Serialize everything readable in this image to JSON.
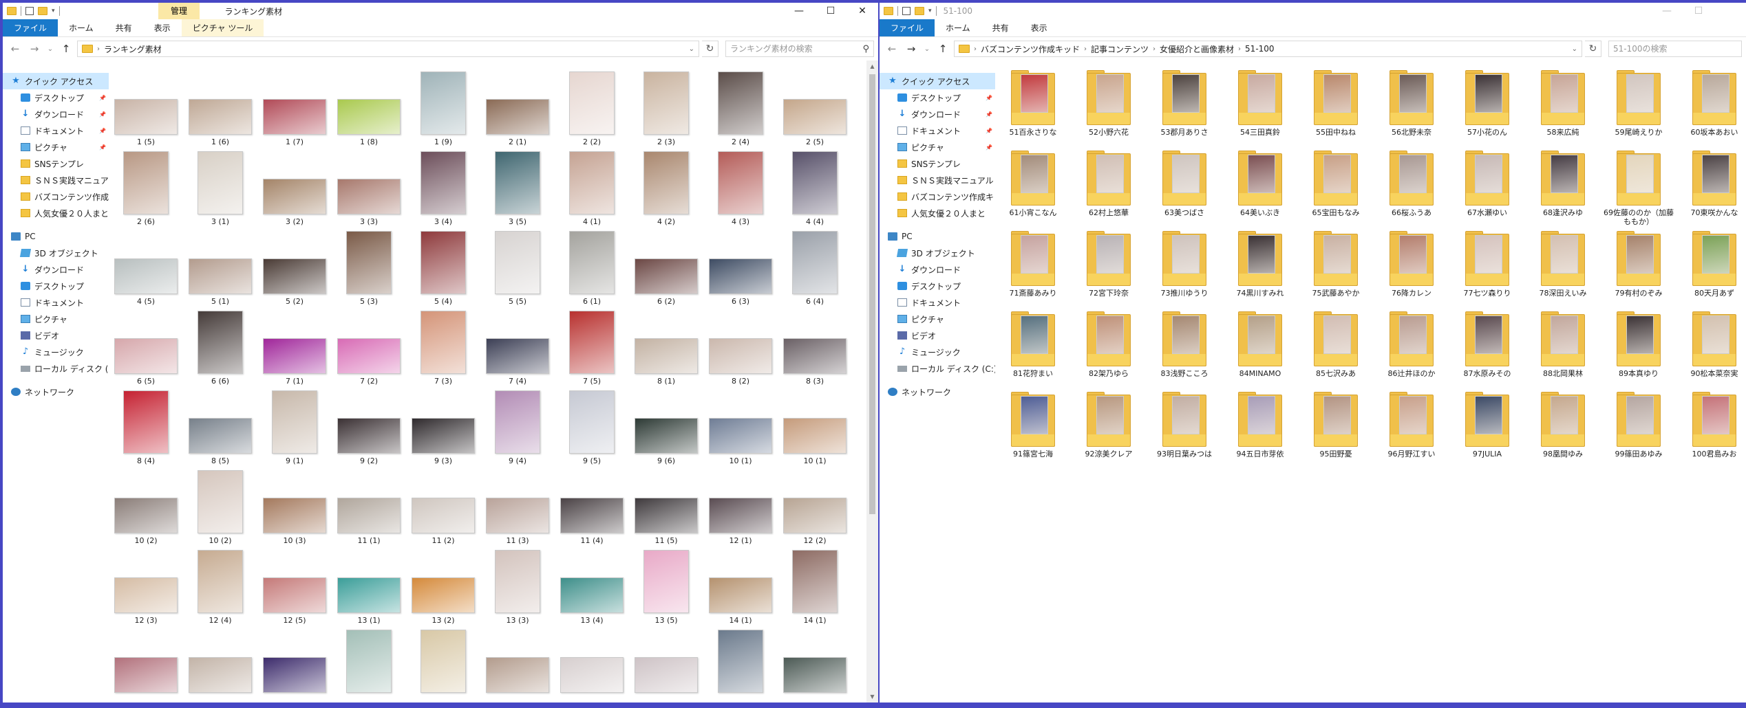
{
  "left": {
    "manage_tab": "管理",
    "title": "ランキング素材",
    "ribbon_tabs": [
      "ファイル",
      "ホーム",
      "共有",
      "表示",
      "ピクチャ ツール"
    ],
    "address": {
      "crumbs": [
        "ランキング素材"
      ]
    },
    "search_placeholder": "ランキング素材の検索",
    "nav": [
      {
        "label": "クイック アクセス",
        "icon": "star-icon"
      },
      {
        "label": "デスクトップ",
        "icon": "desktop-icon",
        "pinned": true
      },
      {
        "label": "ダウンロード",
        "icon": "download-icon",
        "pinned": true
      },
      {
        "label": "ドキュメント",
        "icon": "document-icon",
        "pinned": true
      },
      {
        "label": "ピクチャ",
        "icon": "pictures-icon",
        "pinned": true
      },
      {
        "label": "SNSテンプレ",
        "icon": "folder-icon"
      },
      {
        "label": "ＳＮＳ実践マニュアル",
        "icon": "folder-icon"
      },
      {
        "label": "バズコンテンツ作成キッ",
        "icon": "folder-icon"
      },
      {
        "label": "人気女優２０人まと",
        "icon": "folder-icon"
      },
      {
        "label": "PC",
        "icon": "pc-icon"
      },
      {
        "label": "3D オブジェクト",
        "icon": "3d-objects-icon"
      },
      {
        "label": "ダウンロード",
        "icon": "download-icon"
      },
      {
        "label": "デスクトップ",
        "icon": "desktop-icon"
      },
      {
        "label": "ドキュメント",
        "icon": "document-icon"
      },
      {
        "label": "ピクチャ",
        "icon": "pictures-icon"
      },
      {
        "label": "ビデオ",
        "icon": "video-icon"
      },
      {
        "label": "ミュージック",
        "icon": "music-icon"
      },
      {
        "label": "ローカル ディスク (C:)",
        "icon": "drive-icon"
      },
      {
        "label": "ネットワーク",
        "icon": "network-icon"
      }
    ],
    "files": [
      {
        "label": "1 (5)",
        "o": "l",
        "c": "#c8b3a6"
      },
      {
        "label": "1 (6)",
        "o": "l",
        "c": "#bfa895"
      },
      {
        "label": "1 (7)",
        "o": "l",
        "c": "#b14a57"
      },
      {
        "label": "1 (8)",
        "o": "l",
        "c": "#a9c94e"
      },
      {
        "label": "1 (9)",
        "o": "p",
        "c": "#9fb3b8"
      },
      {
        "label": "2 (1)",
        "o": "l",
        "c": "#8a6a55"
      },
      {
        "label": "2 (2)",
        "o": "p",
        "c": "#e6d6d0"
      },
      {
        "label": "2 (3)",
        "o": "p",
        "c": "#c9b39f"
      },
      {
        "label": "2 (4)",
        "o": "p",
        "c": "#5b4d49"
      },
      {
        "label": "2 (5)",
        "o": "l",
        "c": "#c4a68a"
      },
      {
        "label": "2 (6)",
        "o": "p",
        "c": "#b89884"
      },
      {
        "label": "3 (1)",
        "o": "p",
        "c": "#d8d0c6"
      },
      {
        "label": "3 (2)",
        "o": "l",
        "c": "#a48468"
      },
      {
        "label": "3 (3)",
        "o": "l",
        "c": "#a7786c"
      },
      {
        "label": "3 (4)",
        "o": "p",
        "c": "#6c4e5a"
      },
      {
        "label": "3 (5)",
        "o": "p",
        "c": "#3f6670"
      },
      {
        "label": "4 (1)",
        "o": "p",
        "c": "#c5a393"
      },
      {
        "label": "4 (2)",
        "o": "p",
        "c": "#a9876e"
      },
      {
        "label": "4 (3)",
        "o": "p",
        "c": "#b45c58"
      },
      {
        "label": "4 (4)",
        "o": "p",
        "c": "#575069"
      },
      {
        "label": "4 (5)",
        "o": "l",
        "c": "#b8bfbf"
      },
      {
        "label": "5 (1)",
        "o": "l",
        "c": "#b39c8e"
      },
      {
        "label": "5 (2)",
        "o": "l",
        "c": "#4a3b35"
      },
      {
        "label": "5 (3)",
        "o": "p",
        "c": "#7a5a47"
      },
      {
        "label": "5 (4)",
        "o": "p",
        "c": "#8e3a3c"
      },
      {
        "label": "5 (5)",
        "o": "p",
        "c": "#d7d3d1"
      },
      {
        "label": "6 (1)",
        "o": "p",
        "c": "#a4a39e"
      },
      {
        "label": "6 (2)",
        "o": "l",
        "c": "#6b4744"
      },
      {
        "label": "6 (3)",
        "o": "l",
        "c": "#3e4c63"
      },
      {
        "label": "6 (4)",
        "o": "p",
        "c": "#9aa0a9"
      },
      {
        "label": "6 (5)",
        "o": "l",
        "c": "#d6a7ab"
      },
      {
        "label": "6 (6)",
        "o": "p",
        "c": "#453b39"
      },
      {
        "label": "7 (1)",
        "o": "l",
        "c": "#a0269a"
      },
      {
        "label": "7 (2)",
        "o": "l",
        "c": "#d86bb5"
      },
      {
        "label": "7 (3)",
        "o": "p",
        "c": "#d49478"
      },
      {
        "label": "7 (4)",
        "o": "l",
        "c": "#3c3f55"
      },
      {
        "label": "7 (5)",
        "o": "p",
        "c": "#b8312f"
      },
      {
        "label": "8 (1)",
        "o": "l",
        "c": "#c3b2a3"
      },
      {
        "label": "8 (2)",
        "o": "l",
        "c": "#cbb8ad"
      },
      {
        "label": "8 (3)",
        "o": "l",
        "c": "#6a6065"
      },
      {
        "label": "8 (4)",
        "o": "p",
        "c": "#c52232"
      },
      {
        "label": "8 (5)",
        "o": "l",
        "c": "#77808a"
      },
      {
        "label": "9 (1)",
        "o": "p",
        "c": "#c7b8aa"
      },
      {
        "label": "9 (2)",
        "o": "l",
        "c": "#3b3134"
      },
      {
        "label": "9 (3)",
        "o": "l",
        "c": "#2f2a2d"
      },
      {
        "label": "9 (4)",
        "o": "p",
        "c": "#b28cb5"
      },
      {
        "label": "9 (5)",
        "o": "p",
        "c": "#c6c9d3"
      },
      {
        "label": "9 (6)",
        "o": "l",
        "c": "#2d3a35"
      },
      {
        "label": "10 (1)",
        "o": "l",
        "c": "#6f7d95"
      },
      {
        "label": "10 (1)",
        "o": "l",
        "c": "#c59b7b"
      },
      {
        "label": "10 (2)",
        "o": "l",
        "c": "#8a7d78"
      },
      {
        "label": "10 (2)",
        "o": "p",
        "c": "#d5c6bd"
      },
      {
        "label": "10 (3)",
        "o": "l",
        "c": "#a4795d"
      },
      {
        "label": "11 (1)",
        "o": "l",
        "c": "#b0a69c"
      },
      {
        "label": "11 (2)",
        "o": "l",
        "c": "#cfc6bf"
      },
      {
        "label": "11 (3)",
        "o": "l",
        "c": "#b9a39a"
      },
      {
        "label": "11 (4)",
        "o": "l",
        "c": "#4b4346"
      },
      {
        "label": "11 (5)",
        "o": "l",
        "c": "#3f3a3d"
      },
      {
        "label": "12 (1)",
        "o": "l",
        "c": "#5a4c52"
      },
      {
        "label": "12 (2)",
        "o": "l",
        "c": "#b7a493"
      },
      {
        "label": "12 (3)",
        "o": "l",
        "c": "#d5bca4"
      },
      {
        "label": "12 (4)",
        "o": "p",
        "c": "#c6ab91"
      },
      {
        "label": "12 (5)",
        "o": "l",
        "c": "#c57a79"
      },
      {
        "label": "13 (1)",
        "o": "l",
        "c": "#3b9e99"
      },
      {
        "label": "13 (2)",
        "o": "l",
        "c": "#d58a3b"
      },
      {
        "label": "13 (3)",
        "o": "p",
        "c": "#d3c3bd"
      },
      {
        "label": "13 (4)",
        "o": "l",
        "c": "#3e8f8a"
      },
      {
        "label": "13 (5)",
        "o": "p",
        "c": "#e8a9c7"
      },
      {
        "label": "14 (1)",
        "o": "l",
        "c": "#b5926f"
      },
      {
        "label": "14 (1)",
        "o": "p",
        "c": "#8d6b63"
      },
      {
        "label": "",
        "o": "l",
        "c": "#b2717c"
      },
      {
        "label": "",
        "o": "l",
        "c": "#c3b4a8"
      },
      {
        "label": "",
        "o": "l",
        "c": "#3d2c6c"
      },
      {
        "label": "",
        "o": "p",
        "c": "#a3bfb7"
      },
      {
        "label": "",
        "o": "p",
        "c": "#d8c8a6"
      },
      {
        "label": "",
        "o": "l",
        "c": "#b39c8d"
      },
      {
        "label": "",
        "o": "l",
        "c": "#d7cfcf"
      },
      {
        "label": "",
        "o": "l",
        "c": "#cec3c6"
      },
      {
        "label": "",
        "o": "p",
        "c": "#6b7a8c"
      },
      {
        "label": "",
        "o": "l",
        "c": "#4c5a55"
      }
    ]
  },
  "right": {
    "title": "51-100",
    "ribbon_tabs": [
      "ファイル",
      "ホーム",
      "共有",
      "表示"
    ],
    "address": {
      "crumbs": [
        "バズコンテンツ作成キッド",
        "記事コンテンツ",
        "女優紹介と画像素材",
        "51-100"
      ]
    },
    "search_placeholder": "51-100の検索",
    "nav": [
      {
        "label": "クイック アクセス",
        "icon": "star-icon"
      },
      {
        "label": "デスクトップ",
        "icon": "desktop-icon",
        "pinned": true
      },
      {
        "label": "ダウンロード",
        "icon": "download-icon",
        "pinned": true
      },
      {
        "label": "ドキュメント",
        "icon": "document-icon",
        "pinned": true
      },
      {
        "label": "ピクチャ",
        "icon": "pictures-icon",
        "pinned": true
      },
      {
        "label": "SNSテンプレ",
        "icon": "folder-icon"
      },
      {
        "label": "ＳＮＳ実践マニュアル",
        "icon": "folder-icon"
      },
      {
        "label": "バズコンテンツ作成キッ",
        "icon": "folder-icon"
      },
      {
        "label": "人気女優２０人まと",
        "icon": "folder-icon"
      },
      {
        "label": "PC",
        "icon": "pc-icon"
      },
      {
        "label": "3D オブジェクト",
        "icon": "3d-objects-icon"
      },
      {
        "label": "ダウンロード",
        "icon": "download-icon"
      },
      {
        "label": "デスクトップ",
        "icon": "desktop-icon"
      },
      {
        "label": "ドキュメント",
        "icon": "document-icon"
      },
      {
        "label": "ピクチャ",
        "icon": "pictures-icon"
      },
      {
        "label": "ビデオ",
        "icon": "video-icon"
      },
      {
        "label": "ミュージック",
        "icon": "music-icon"
      },
      {
        "label": "ローカル ディスク (C:)",
        "icon": "drive-icon"
      },
      {
        "label": "ネットワーク",
        "icon": "network-icon"
      }
    ],
    "folders": [
      {
        "label": "51百永さりな",
        "c": "#c23b3f"
      },
      {
        "label": "52小野六花",
        "c": "#c9a58e"
      },
      {
        "label": "53郡月ありさ",
        "c": "#4d4340"
      },
      {
        "label": "54三田真鈴",
        "c": "#c8aaa1"
      },
      {
        "label": "55田中ねね",
        "c": "#b9886c"
      },
      {
        "label": "56北野未奈",
        "c": "#6b5b57"
      },
      {
        "label": "57小花のん",
        "c": "#3b3236"
      },
      {
        "label": "58来広純",
        "c": "#c7a597"
      },
      {
        "label": "59尾崎えりか",
        "c": "#d2c6c0"
      },
      {
        "label": "60坂本あおい",
        "c": "#b8a89b"
      },
      {
        "label": "61小宵こなん",
        "c": "#a38c7b"
      },
      {
        "label": "62村上悠華",
        "c": "#d1bfb5"
      },
      {
        "label": "63美つばさ",
        "c": "#cfc5c0"
      },
      {
        "label": "64美いぶき",
        "c": "#7b4f52"
      },
      {
        "label": "65宝田もなみ",
        "c": "#c8a087"
      },
      {
        "label": "66桜ふうあ",
        "c": "#a89893"
      },
      {
        "label": "67水瀬ゆい",
        "c": "#c7b9b6"
      },
      {
        "label": "68逢沢みゆ",
        "c": "#453c44"
      },
      {
        "label": "69佐藤ののか（加藤ももか）",
        "c": "#e4d6bd"
      },
      {
        "label": "70東咲かんな",
        "c": "#4b4245"
      },
      {
        "label": "71斎藤あみり",
        "c": "#c6a3a0"
      },
      {
        "label": "72宮下玲奈",
        "c": "#b9b3b6"
      },
      {
        "label": "73推川ゆうり",
        "c": "#cfc3bd"
      },
      {
        "label": "74黒川すみれ",
        "c": "#3a3134"
      },
      {
        "label": "75武藤あやか",
        "c": "#c9b1a3"
      },
      {
        "label": "76降カレン",
        "c": "#b47e6d"
      },
      {
        "label": "77七ツ森りり",
        "c": "#d5c3be"
      },
      {
        "label": "78深田えいみ",
        "c": "#d4c0b2"
      },
      {
        "label": "79有村のぞみ",
        "c": "#a6826b"
      },
      {
        "label": "80天月あず",
        "c": "#7ba257"
      },
      {
        "label": "81花狩まい",
        "c": "#56707f"
      },
      {
        "label": "82架乃ゆら",
        "c": "#bf9179"
      },
      {
        "label": "83浅野こころ",
        "c": "#a58872"
      },
      {
        "label": "84MINAMO",
        "c": "#b4a089"
      },
      {
        "label": "85七沢みあ",
        "c": "#d2bdb3"
      },
      {
        "label": "86辻井ほのか",
        "c": "#b99c91"
      },
      {
        "label": "87水原みその",
        "c": "#5a4a50"
      },
      {
        "label": "88北岡果林",
        "c": "#c2a79c"
      },
      {
        "label": "89本真ゆり",
        "c": "#3c3336"
      },
      {
        "label": "90松本菜奈実",
        "c": "#d3c1b0"
      },
      {
        "label": "91篠宮七海",
        "c": "#4f5e96"
      },
      {
        "label": "92涼美クレア",
        "c": "#b89880"
      },
      {
        "label": "93明日葉みつは",
        "c": "#c2aea3"
      },
      {
        "label": "94五日市芽依",
        "c": "#a89db8"
      },
      {
        "label": "95田野憂",
        "c": "#b39483"
      },
      {
        "label": "96月野江すい",
        "c": "#c8a08b"
      },
      {
        "label": "97JULIA",
        "c": "#3c4a66"
      },
      {
        "label": "98凰間ゆみ",
        "c": "#c5a88e"
      },
      {
        "label": "99篠田あゆみ",
        "c": "#b5a6a1"
      },
      {
        "label": "100君島みお",
        "c": "#c57279"
      }
    ]
  }
}
